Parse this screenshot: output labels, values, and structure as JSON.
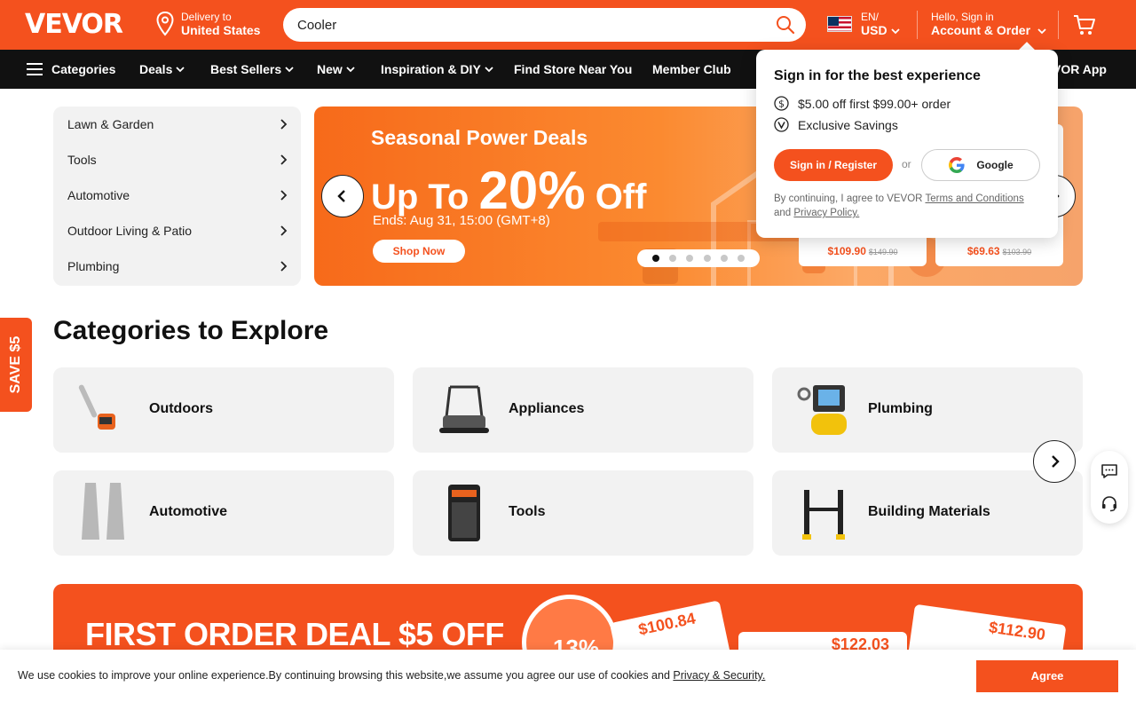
{
  "header": {
    "logo": "VEVOR",
    "delivery_line1": "Delivery to",
    "delivery_line2": "United States",
    "search_value": "Cooler",
    "lang_line1": "EN/",
    "lang_line2": "USD",
    "account_line1": "Hello, Sign in",
    "account_line2": "Account & Order"
  },
  "nav": {
    "categories": "Categories",
    "deals": "Deals",
    "best_sellers": "Best Sellers",
    "new": "New",
    "inspiration": "Inspiration & DIY",
    "find_store": "Find Store Near You",
    "member_club": "Member Club",
    "app": "VOR App"
  },
  "side_categories": [
    "Lawn & Garden",
    "Tools",
    "Automotive",
    "Outdoor Living & Patio",
    "Plumbing"
  ],
  "banner": {
    "title": "Seasonal Power Deals",
    "upto_prefix": "Up To",
    "upto_big": "20%",
    "upto_suffix": "Off",
    "ends": "Ends: Aug 31, 15:00 (GMT+8)",
    "shop_now": "Shop Now",
    "active_slide": 1,
    "slide_count": 6,
    "products": [
      {
        "price": "$109.90",
        "old_price": "$149.90"
      },
      {
        "price": "$69.63",
        "old_price": "$103.90"
      }
    ]
  },
  "signin_popup": {
    "title": "Sign in for the best experience",
    "benefit1": "$5.00 off first $99.00+ order",
    "benefit2": "Exclusive Savings",
    "signin_button": "Sign in / Register",
    "or": "or",
    "google_button": "Google",
    "legal_prefix": "By continuing, I agree to VEVOR",
    "terms": "Terms and Conditions",
    "and": "and",
    "privacy": "Privacy Policy."
  },
  "save_tab": "SAVE $5",
  "explore": {
    "heading": "Categories to Explore",
    "tiles": [
      "Outdoors",
      "Appliances",
      "Plumbing",
      "Automotive",
      "Tools",
      "Building Materials"
    ]
  },
  "promo": {
    "title": "FIRST ORDER DEAL $5 OFF",
    "circle": "13%",
    "prices": [
      "$100.84",
      "$122.03",
      "$112.90"
    ]
  },
  "cookie": {
    "text": "We use cookies to improve your online experience.By continuing browsing this website,we assume you agree our use of cookies and",
    "link": "Privacy & Security.",
    "agree": "Agree"
  },
  "colors": {
    "brand": "#f4511e",
    "nav_bg": "#111111",
    "panel_bg": "#f2f2f2"
  }
}
